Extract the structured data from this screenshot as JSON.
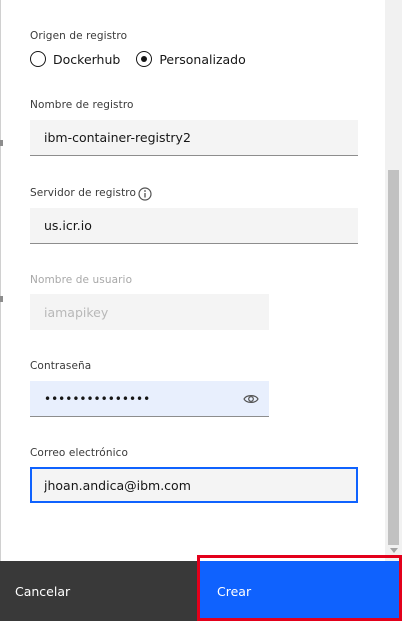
{
  "registry_origin": {
    "label": "Origen de registro",
    "options": [
      {
        "label": "Dockerhub",
        "checked": false
      },
      {
        "label": "Personalizado",
        "checked": true
      }
    ]
  },
  "registry_name": {
    "label": "Nombre de registro",
    "value": "ibm-container-registry2"
  },
  "registry_server": {
    "label": "Servidor de registro",
    "value": "us.icr.io",
    "info_icon": "info-icon"
  },
  "username": {
    "label": "Nombre de usuario",
    "value": "iamapikey",
    "disabled": true
  },
  "password": {
    "label": "Contraseña",
    "value": "•••••••••••••••",
    "toggle_icon": "eye-icon"
  },
  "email": {
    "label": "Correo electrónico",
    "value": "jhoan.andica@ibm.com"
  },
  "footer": {
    "cancel_label": "Cancelar",
    "create_label": "Crear"
  },
  "colors": {
    "primary": "#0f62fe",
    "secondary": "#393939",
    "highlight": "#e3001b"
  }
}
